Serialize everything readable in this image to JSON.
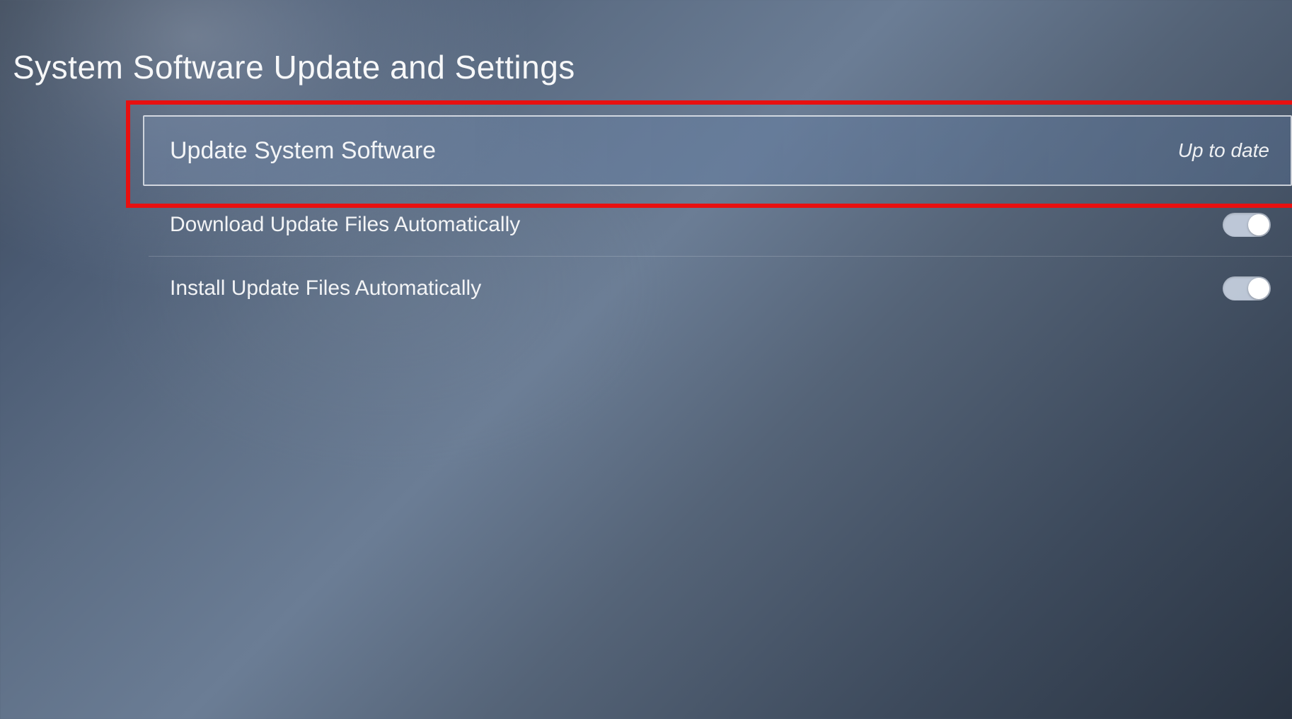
{
  "page": {
    "title": "System Software Update and Settings"
  },
  "rows": [
    {
      "label": "Update System Software",
      "status": "Up to date"
    },
    {
      "label": "Download Update Files Automatically"
    },
    {
      "label": "Install Update Files Automatically"
    }
  ]
}
